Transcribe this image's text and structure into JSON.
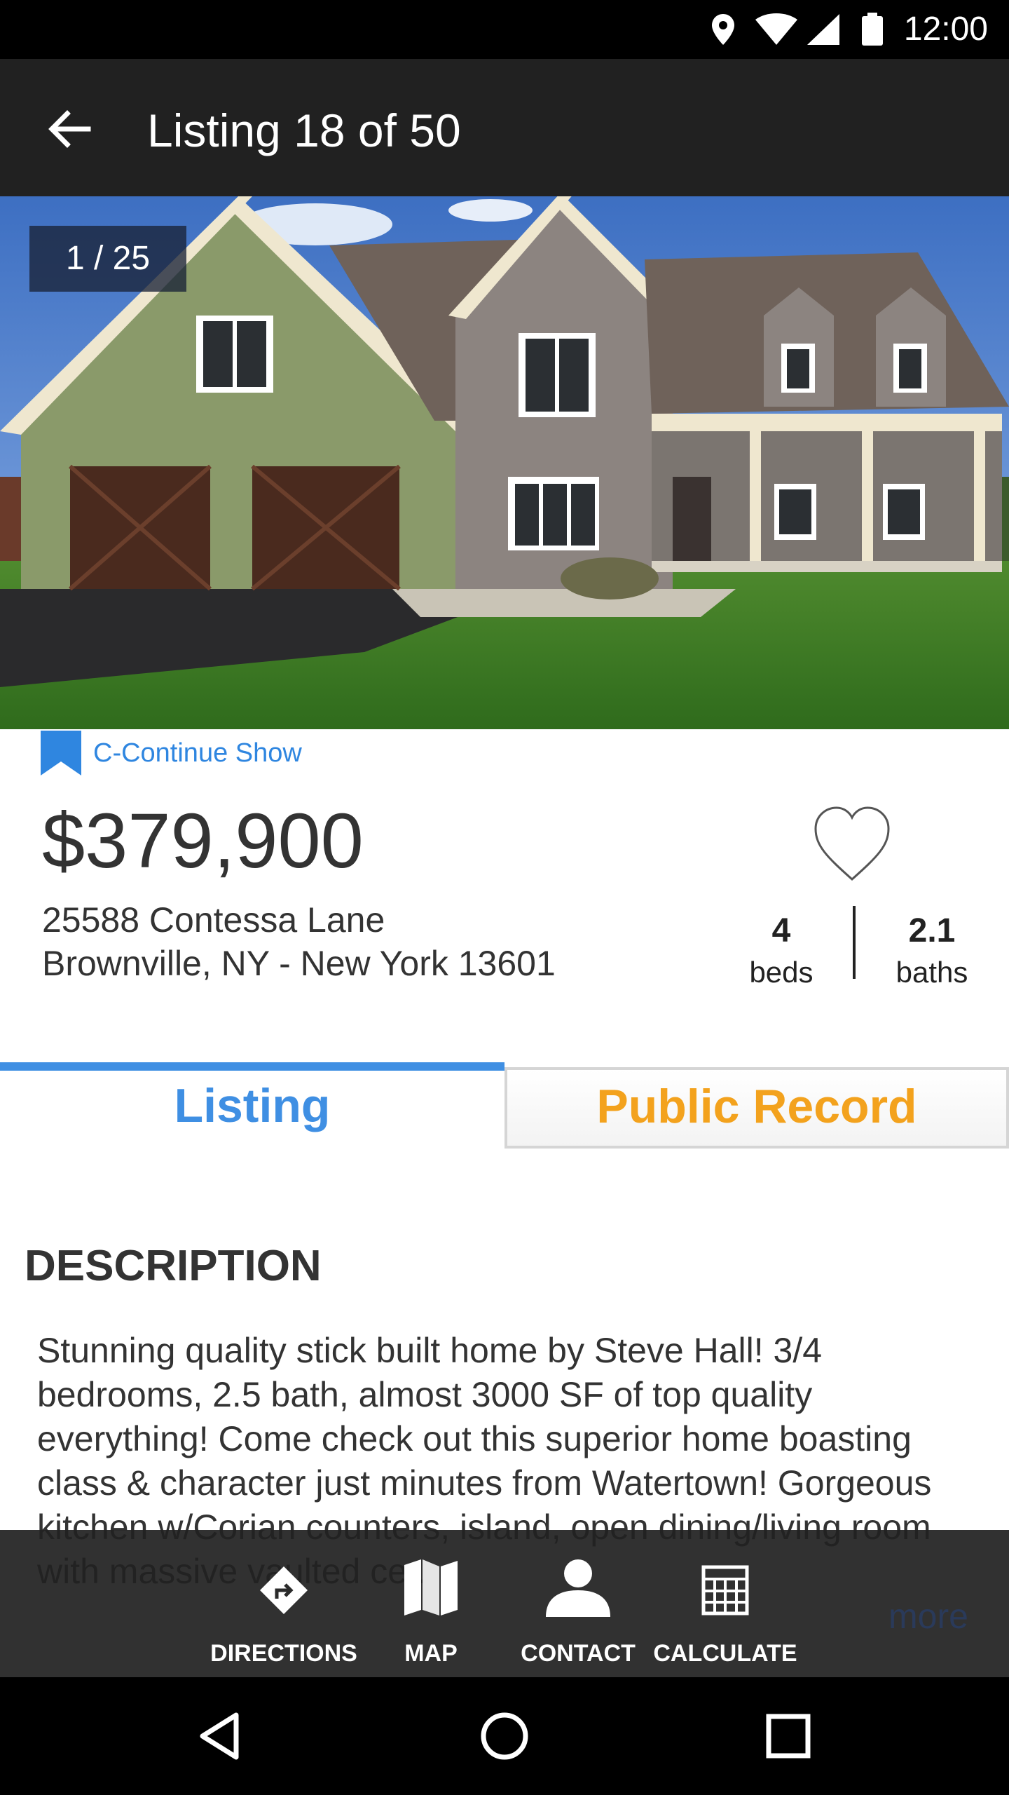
{
  "status_bar": {
    "time": "12:00",
    "icons": [
      "location-icon",
      "wifi-icon",
      "cell-signal-icon",
      "battery-icon"
    ]
  },
  "app_bar": {
    "title": "Listing 18 of 50",
    "back_icon": "arrow-back-icon"
  },
  "gallery": {
    "counter": "1 / 25"
  },
  "listing": {
    "status_label": "C-Continue Show",
    "price": "$379,900",
    "address_line1": "25588 Contessa Lane",
    "address_line2": "Brownville, NY - New York 13601",
    "beds_value": "4",
    "beds_label": "beds",
    "baths_value": "2.1",
    "baths_label": "baths"
  },
  "tabs": [
    {
      "label": "Listing",
      "active": true
    },
    {
      "label": "Public Record",
      "active": false
    }
  ],
  "description": {
    "heading": "DESCRIPTION",
    "text": "Stunning quality stick built home by Steve Hall! 3/4 bedrooms, 2.5 bath, almost 3000 SF of top quality everything! Come check out this superior home boasting class & character just minutes from Watertown! Gorgeous kitchen w/Corian counters, island, open dining/living room with massive vaulted ce..."
  },
  "actions": [
    {
      "label": "DIRECTIONS",
      "icon": "directions-icon"
    },
    {
      "label": "MAP",
      "icon": "map-icon"
    },
    {
      "label": "CONTACT",
      "icon": "contact-person-icon"
    },
    {
      "label": "CALCULATE",
      "icon": "calculator-icon"
    }
  ],
  "more_label": "more",
  "colors": {
    "accent_blue": "#3f8fe3",
    "accent_orange": "#f3a21d",
    "app_bar": "#212121"
  }
}
